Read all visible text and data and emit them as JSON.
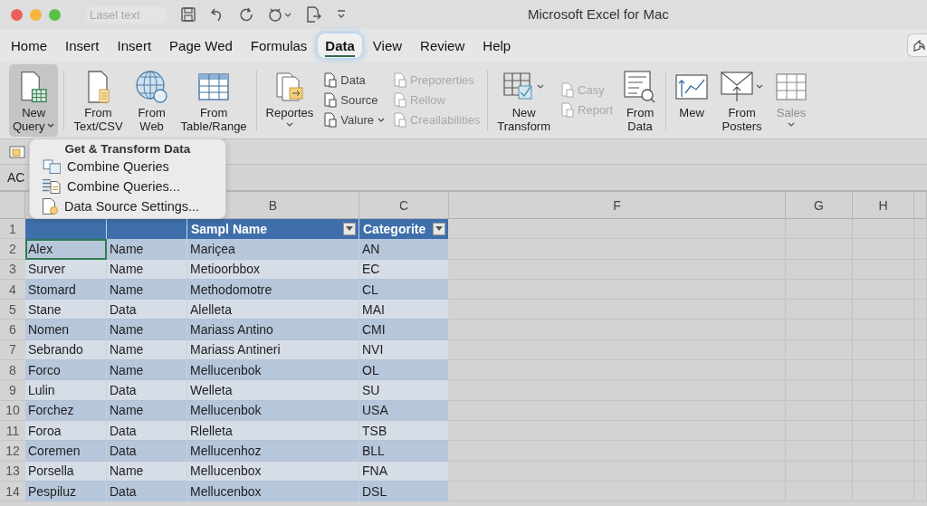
{
  "window": {
    "title": "Microsoft Excel for Mac",
    "doc_name": "Lasel text"
  },
  "tabs": [
    {
      "label": "Home",
      "selected": false
    },
    {
      "label": "Insert",
      "selected": false
    },
    {
      "label": "Insert",
      "selected": false
    },
    {
      "label": "Page Wed",
      "selected": false
    },
    {
      "label": "Formulas",
      "selected": false
    },
    {
      "label": "Data",
      "selected": true
    },
    {
      "label": "View",
      "selected": false
    },
    {
      "label": "Review",
      "selected": false
    },
    {
      "label": "Help",
      "selected": false
    }
  ],
  "ribbon": [
    {
      "kind": "large",
      "lines": [
        "New",
        "Query"
      ],
      "dropdown": true,
      "pressed": true,
      "disabled": false
    },
    {
      "kind": "separator"
    },
    {
      "kind": "large",
      "lines": [
        "From",
        "Text/CSV"
      ],
      "dropdown": false,
      "pressed": false,
      "disabled": false
    },
    {
      "kind": "large",
      "lines": [
        "From",
        "Web"
      ],
      "dropdown": false,
      "pressed": false,
      "disabled": false
    },
    {
      "kind": "large",
      "lines": [
        "From",
        "Table/Range"
      ],
      "dropdown": false,
      "pressed": false,
      "disabled": false
    },
    {
      "kind": "separator"
    },
    {
      "kind": "large",
      "lines": [
        "Reportes"
      ],
      "dropdown": true,
      "pressed": false,
      "disabled": false
    },
    {
      "kind": "stack",
      "items": [
        {
          "label": "Data",
          "disabled": false,
          "dropdown": false
        },
        {
          "label": "Source",
          "disabled": false,
          "dropdown": false
        },
        {
          "label": "Valure",
          "disabled": false,
          "dropdown": true
        }
      ]
    },
    {
      "kind": "stack",
      "items": [
        {
          "label": "Preporerties",
          "disabled": true,
          "dropdown": false
        },
        {
          "label": "Rellow",
          "disabled": true,
          "dropdown": false
        },
        {
          "label": "Creailabilities",
          "disabled": true,
          "dropdown": false
        }
      ]
    },
    {
      "kind": "separator"
    },
    {
      "kind": "large",
      "lines": [
        "New",
        "Transform"
      ],
      "dropdown": true,
      "pressed": false,
      "disabled": false
    },
    {
      "kind": "stack",
      "items": [
        {
          "label": "Casy",
          "disabled": true,
          "dropdown": false
        },
        {
          "label": "Report",
          "disabled": true,
          "dropdown": false
        }
      ]
    },
    {
      "kind": "large",
      "lines": [
        "From",
        "Data"
      ],
      "dropdown": false,
      "pressed": false,
      "disabled": false
    },
    {
      "kind": "separator"
    },
    {
      "kind": "large",
      "lines": [
        "Mew"
      ],
      "dropdown": false,
      "pressed": false,
      "disabled": false
    },
    {
      "kind": "large",
      "lines": [
        "From",
        "Posters"
      ],
      "dropdown": true,
      "pressed": false,
      "disabled": false
    },
    {
      "kind": "large",
      "lines": [
        "Sales"
      ],
      "dropdown": true,
      "pressed": false,
      "disabled": true
    }
  ],
  "name_box": "AC",
  "menu": {
    "title": "Get & Transform Data",
    "items": [
      "Combine Queries",
      "Combine Queries...",
      "Data Source Settings..."
    ]
  },
  "column_headers": [
    "B",
    "C",
    "F",
    "G",
    "H"
  ],
  "table": {
    "header_row": "1",
    "headers": [
      "Sampl Name",
      "Categorite"
    ],
    "rows": [
      {
        "num": "2",
        "cells": [
          "Alex",
          "Name",
          "Mariçea",
          "AN"
        ],
        "selected": true
      },
      {
        "num": "3",
        "cells": [
          "Surver",
          "Name",
          "Metioorbbox",
          "EC"
        ],
        "selected": false
      },
      {
        "num": "4",
        "cells": [
          "Stomard",
          "Name",
          "Methodomotre",
          "CL"
        ],
        "selected": false
      },
      {
        "num": "5",
        "cells": [
          "Stane",
          "Data",
          "Alelleta",
          "MAI"
        ],
        "selected": false
      },
      {
        "num": "6",
        "cells": [
          "Nomen",
          "Name",
          "Mariass Antino",
          "CMI"
        ],
        "selected": false
      },
      {
        "num": "7",
        "cells": [
          "Sebrando",
          "Name",
          "Mariass Antineri",
          "NVI"
        ],
        "selected": false
      },
      {
        "num": "8",
        "cells": [
          "Forco",
          "Name",
          "Mellucenbok",
          "OL"
        ],
        "selected": false
      },
      {
        "num": "9",
        "cells": [
          "Lulin",
          "Data",
          "Welleta",
          "SU"
        ],
        "selected": false
      },
      {
        "num": "10",
        "cells": [
          "Forchez",
          "Name",
          "Mellucenbok",
          "USA"
        ],
        "selected": false
      },
      {
        "num": "11",
        "cells": [
          "Foroa",
          "Data",
          "Rlelleta",
          "TSB"
        ],
        "selected": false
      },
      {
        "num": "12",
        "cells": [
          "Coremen",
          "Data",
          "Mellucenhoz",
          "BLL"
        ],
        "selected": false
      },
      {
        "num": "13",
        "cells": [
          "Porsella",
          "Name",
          "Mellucenbox",
          "FNA"
        ],
        "selected": false
      },
      {
        "num": "14",
        "cells": [
          "Pespiluz",
          "Data",
          "Mellucenbox",
          "DSL"
        ],
        "selected": false
      }
    ]
  }
}
